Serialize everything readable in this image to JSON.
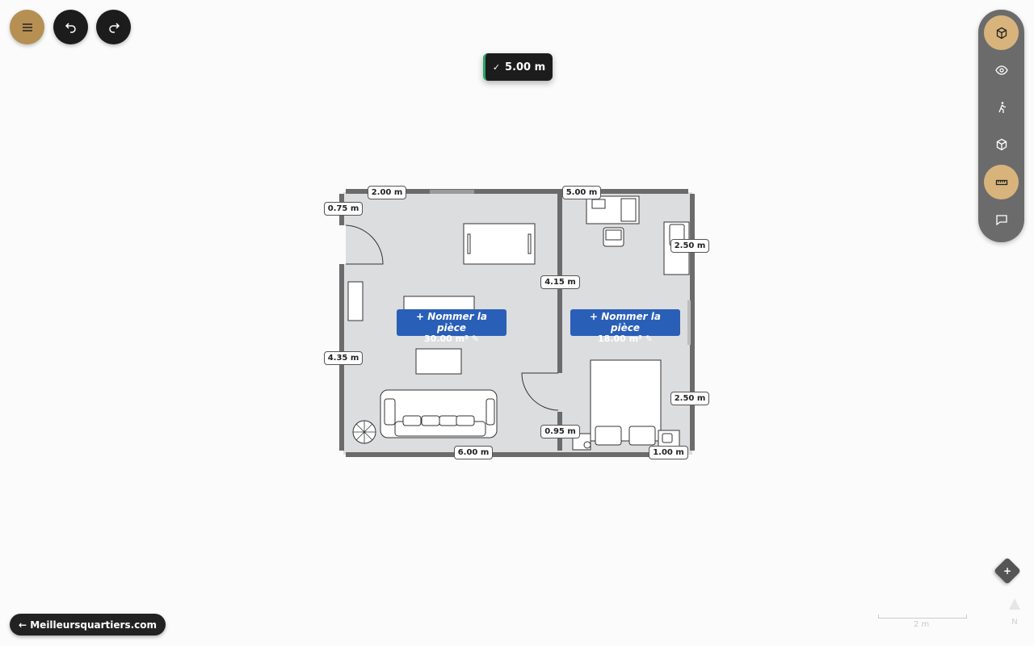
{
  "toast": {
    "check": "✓",
    "text": "5.00 m"
  },
  "top_buttons": {
    "menu": "menu-icon",
    "undo": "undo-icon",
    "redo": "redo-icon"
  },
  "toolbar": {
    "tools": [
      "cube-icon",
      "eye-icon",
      "walk-icon",
      "cube-outline-icon",
      "ruler-icon",
      "comment-icon"
    ],
    "active": [
      "cube-icon",
      "ruler-icon"
    ]
  },
  "dimensions": {
    "top_left": "2.00 m",
    "top_right": "5.00 m",
    "left_door": "0.75 m",
    "right_upper": "2.50 m",
    "middle_wall": "4.15 m",
    "left_side": "4.35 m",
    "right_lower": "2.50 m",
    "bottom_door": "0.95 m",
    "bottom": "6.00 m",
    "bottom_right": "1.00 m"
  },
  "rooms": [
    {
      "name": "+ Nommer la pièce",
      "area": "30.00 m² ✎"
    },
    {
      "name": "+ Nommer la pièce",
      "area": "18.00 m² ✎"
    }
  ],
  "back_link": "← Meilleursquartiers.com",
  "add_button": "+",
  "scale_label": "2 m",
  "north_label": "N",
  "colors": {
    "accent_gold": "#b68f53",
    "dark": "#1c1c1c",
    "room_label": "#2a5fb8",
    "wall": "#6b6b6b",
    "floor": "#dcdddf"
  }
}
